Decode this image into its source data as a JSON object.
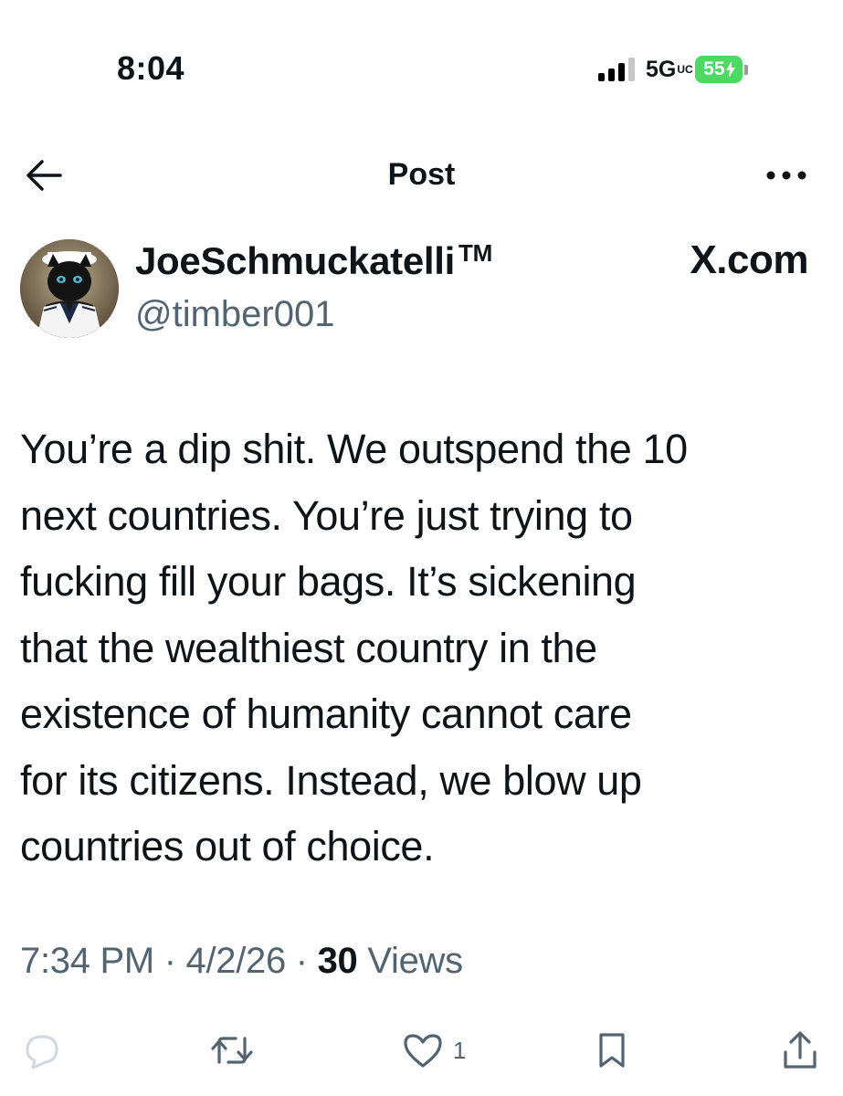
{
  "status_bar": {
    "time": "8:04",
    "network": "5G",
    "network_suffix": "UC",
    "battery": "55"
  },
  "header": {
    "title": "Post",
    "back_icon": "arrow-left-icon",
    "more_icon": "more-dots-icon"
  },
  "author": {
    "display_name": "JoeSchmuckatelli",
    "trademark": "TM",
    "handle": "@timber001",
    "avatar": "black cat in sailor outfit"
  },
  "source_label": "X.com",
  "post": {
    "text": "You’re a dip shit. We outspend the 10\nnext countries. You’re just trying to\nfucking fill your bags. It’s sickening\nthat the wealthiest country in the\nexistence of humanity cannot care\nfor its citizens. Instead, we blow up\ncountries out of choice."
  },
  "meta": {
    "time": "7:34 PM",
    "separator": " · ",
    "date": "4/2/26",
    "views_count": "30",
    "views_label": "Views"
  },
  "actions": {
    "reply_icon": "reply-icon",
    "repost_icon": "repost-icon",
    "like_icon": "heart-icon",
    "like_count": "1",
    "bookmark_icon": "bookmark-icon",
    "share_icon": "share-icon"
  },
  "colors": {
    "text_primary": "#0f1419",
    "text_secondary": "#536471",
    "battery": "#4cd964",
    "reply_icon": "#cfd9de"
  }
}
